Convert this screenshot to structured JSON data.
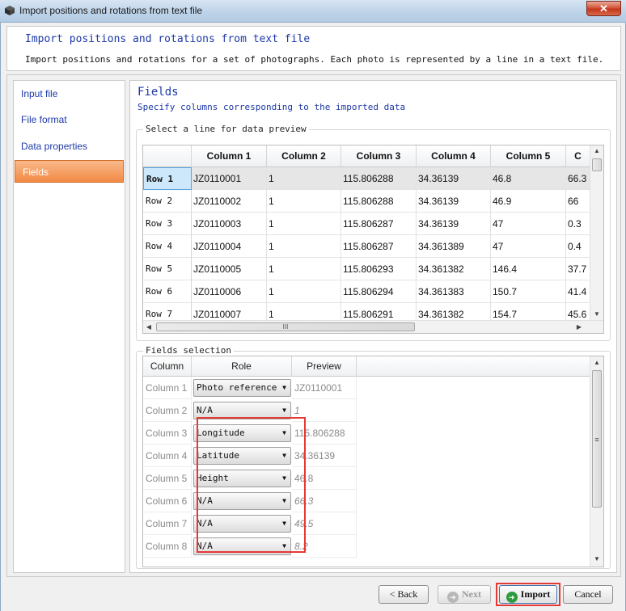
{
  "window": {
    "title": "Import positions and rotations from text file",
    "close_glyph": "✕"
  },
  "header": {
    "title": "Import positions and rotations from text file",
    "subtitle": "Import positions and rotations for a set of photographs. Each photo is represented by a line in a text file."
  },
  "nav": {
    "items": [
      {
        "label": "Input file"
      },
      {
        "label": "File format"
      },
      {
        "label": "Data properties"
      },
      {
        "label": "Fields",
        "selected": true
      }
    ]
  },
  "fields_page": {
    "title": "Fields",
    "subtitle": "Specify columns corresponding to the imported data"
  },
  "preview": {
    "legend": "Select a line for data preview",
    "columns": [
      "Column 1",
      "Column 2",
      "Column 3",
      "Column 4",
      "Column 5",
      "C"
    ],
    "rows": [
      {
        "label": "Row 1",
        "cells": [
          "JZ0110001",
          "1",
          "115.806288",
          "34.36139",
          "46.8",
          "66.3"
        ]
      },
      {
        "label": "Row 2",
        "cells": [
          "JZ0110002",
          "1",
          "115.806288",
          "34.36139",
          "46.9",
          "66"
        ]
      },
      {
        "label": "Row 3",
        "cells": [
          "JZ0110003",
          "1",
          "115.806287",
          "34.36139",
          "47",
          "0.3"
        ]
      },
      {
        "label": "Row 4",
        "cells": [
          "JZ0110004",
          "1",
          "115.806287",
          "34.361389",
          "47",
          "0.4"
        ]
      },
      {
        "label": "Row 5",
        "cells": [
          "JZ0110005",
          "1",
          "115.806293",
          "34.361382",
          "146.4",
          "37.7"
        ]
      },
      {
        "label": "Row 6",
        "cells": [
          "JZ0110006",
          "1",
          "115.806294",
          "34.361383",
          "150.7",
          "41.4"
        ]
      },
      {
        "label": "Row 7",
        "cells": [
          "JZ0110007",
          "1",
          "115.806291",
          "34.361382",
          "154.7",
          "45.6"
        ]
      }
    ],
    "hscroll_mark": "III"
  },
  "fields_selection": {
    "legend": "Fields selection",
    "headers": [
      "Column",
      "Role",
      "Preview"
    ],
    "rows": [
      {
        "column": "Column 1",
        "role": "Photo reference",
        "preview": "JZ0110001",
        "italic": false
      },
      {
        "column": "Column 2",
        "role": "N/A",
        "preview": "1",
        "italic": true
      },
      {
        "column": "Column 3",
        "role": "Longitude",
        "preview": "115.806288",
        "italic": false
      },
      {
        "column": "Column 4",
        "role": "Latitude",
        "preview": "34.36139",
        "italic": false
      },
      {
        "column": "Column 5",
        "role": "Height",
        "preview": "46.8",
        "italic": false
      },
      {
        "column": "Column 6",
        "role": "N/A",
        "preview": "66.3",
        "italic": true
      },
      {
        "column": "Column 7",
        "role": "N/A",
        "preview": "49.5",
        "italic": true
      },
      {
        "column": "Column 8",
        "role": "N/A",
        "preview": "8.2",
        "italic": true
      }
    ],
    "vscroll_mark": "≡"
  },
  "buttons": {
    "back": "< Back",
    "next": "Next",
    "import": "Import",
    "cancel": "Cancel"
  },
  "colors": {
    "accent_blue": "#1d39a8",
    "selected_nav": "#f28a45",
    "highlight_red": "#e53935"
  }
}
